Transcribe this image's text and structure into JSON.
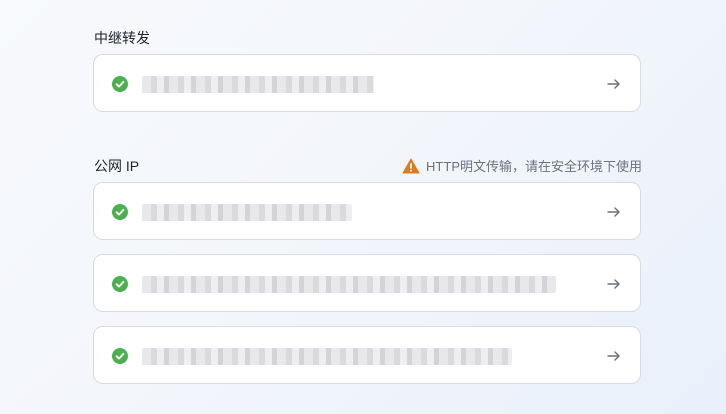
{
  "relay": {
    "title": "中继转发",
    "status": "connected"
  },
  "public_ip": {
    "title": "公网 IP",
    "warning_text": "HTTP明文传输，请在安全环境下使用",
    "items": [
      {
        "status": "connected"
      },
      {
        "status": "connected"
      },
      {
        "status": "connected"
      }
    ]
  },
  "colors": {
    "success": "#4caf50",
    "warning": "#e07a1f",
    "arrow": "#6b7280"
  },
  "icons": {
    "status": "check-circle-icon",
    "navigate": "arrow-right-icon",
    "warning": "warning-triangle-icon"
  }
}
